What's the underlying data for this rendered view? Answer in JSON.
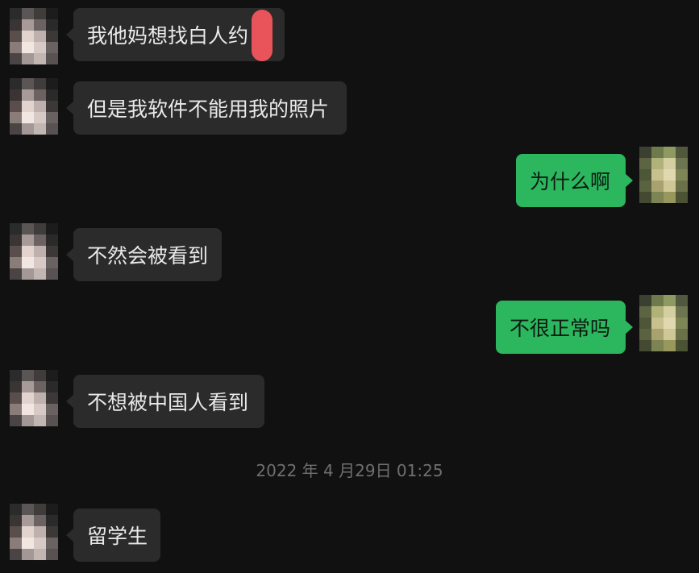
{
  "colors": {
    "background": "#111111",
    "incoming_bubble": "#2b2b2b",
    "outgoing_bubble": "#2cb75f",
    "incoming_text": "#e9e9e9",
    "outgoing_text": "#0d1a10",
    "timestamp_text": "#6f6f6f",
    "censor_mark": "#e9535a"
  },
  "contact_avatar": "pixelated-avatar",
  "self_avatar": "pixelated-avatar",
  "messages": [
    {
      "side": "incoming",
      "text": "我他妈想找白人约"
    },
    {
      "side": "incoming",
      "text": "但是我软件不能用我的照片"
    },
    {
      "side": "outgoing",
      "text": "为什么啊"
    },
    {
      "side": "incoming",
      "text": "不然会被看到"
    },
    {
      "side": "outgoing",
      "text": "不很正常吗"
    },
    {
      "side": "incoming",
      "text": "不想被中国人看到"
    },
    {
      "side": "incoming",
      "text": "留学生"
    }
  ],
  "timestamp": "2022 年 4 月29日 01:25"
}
